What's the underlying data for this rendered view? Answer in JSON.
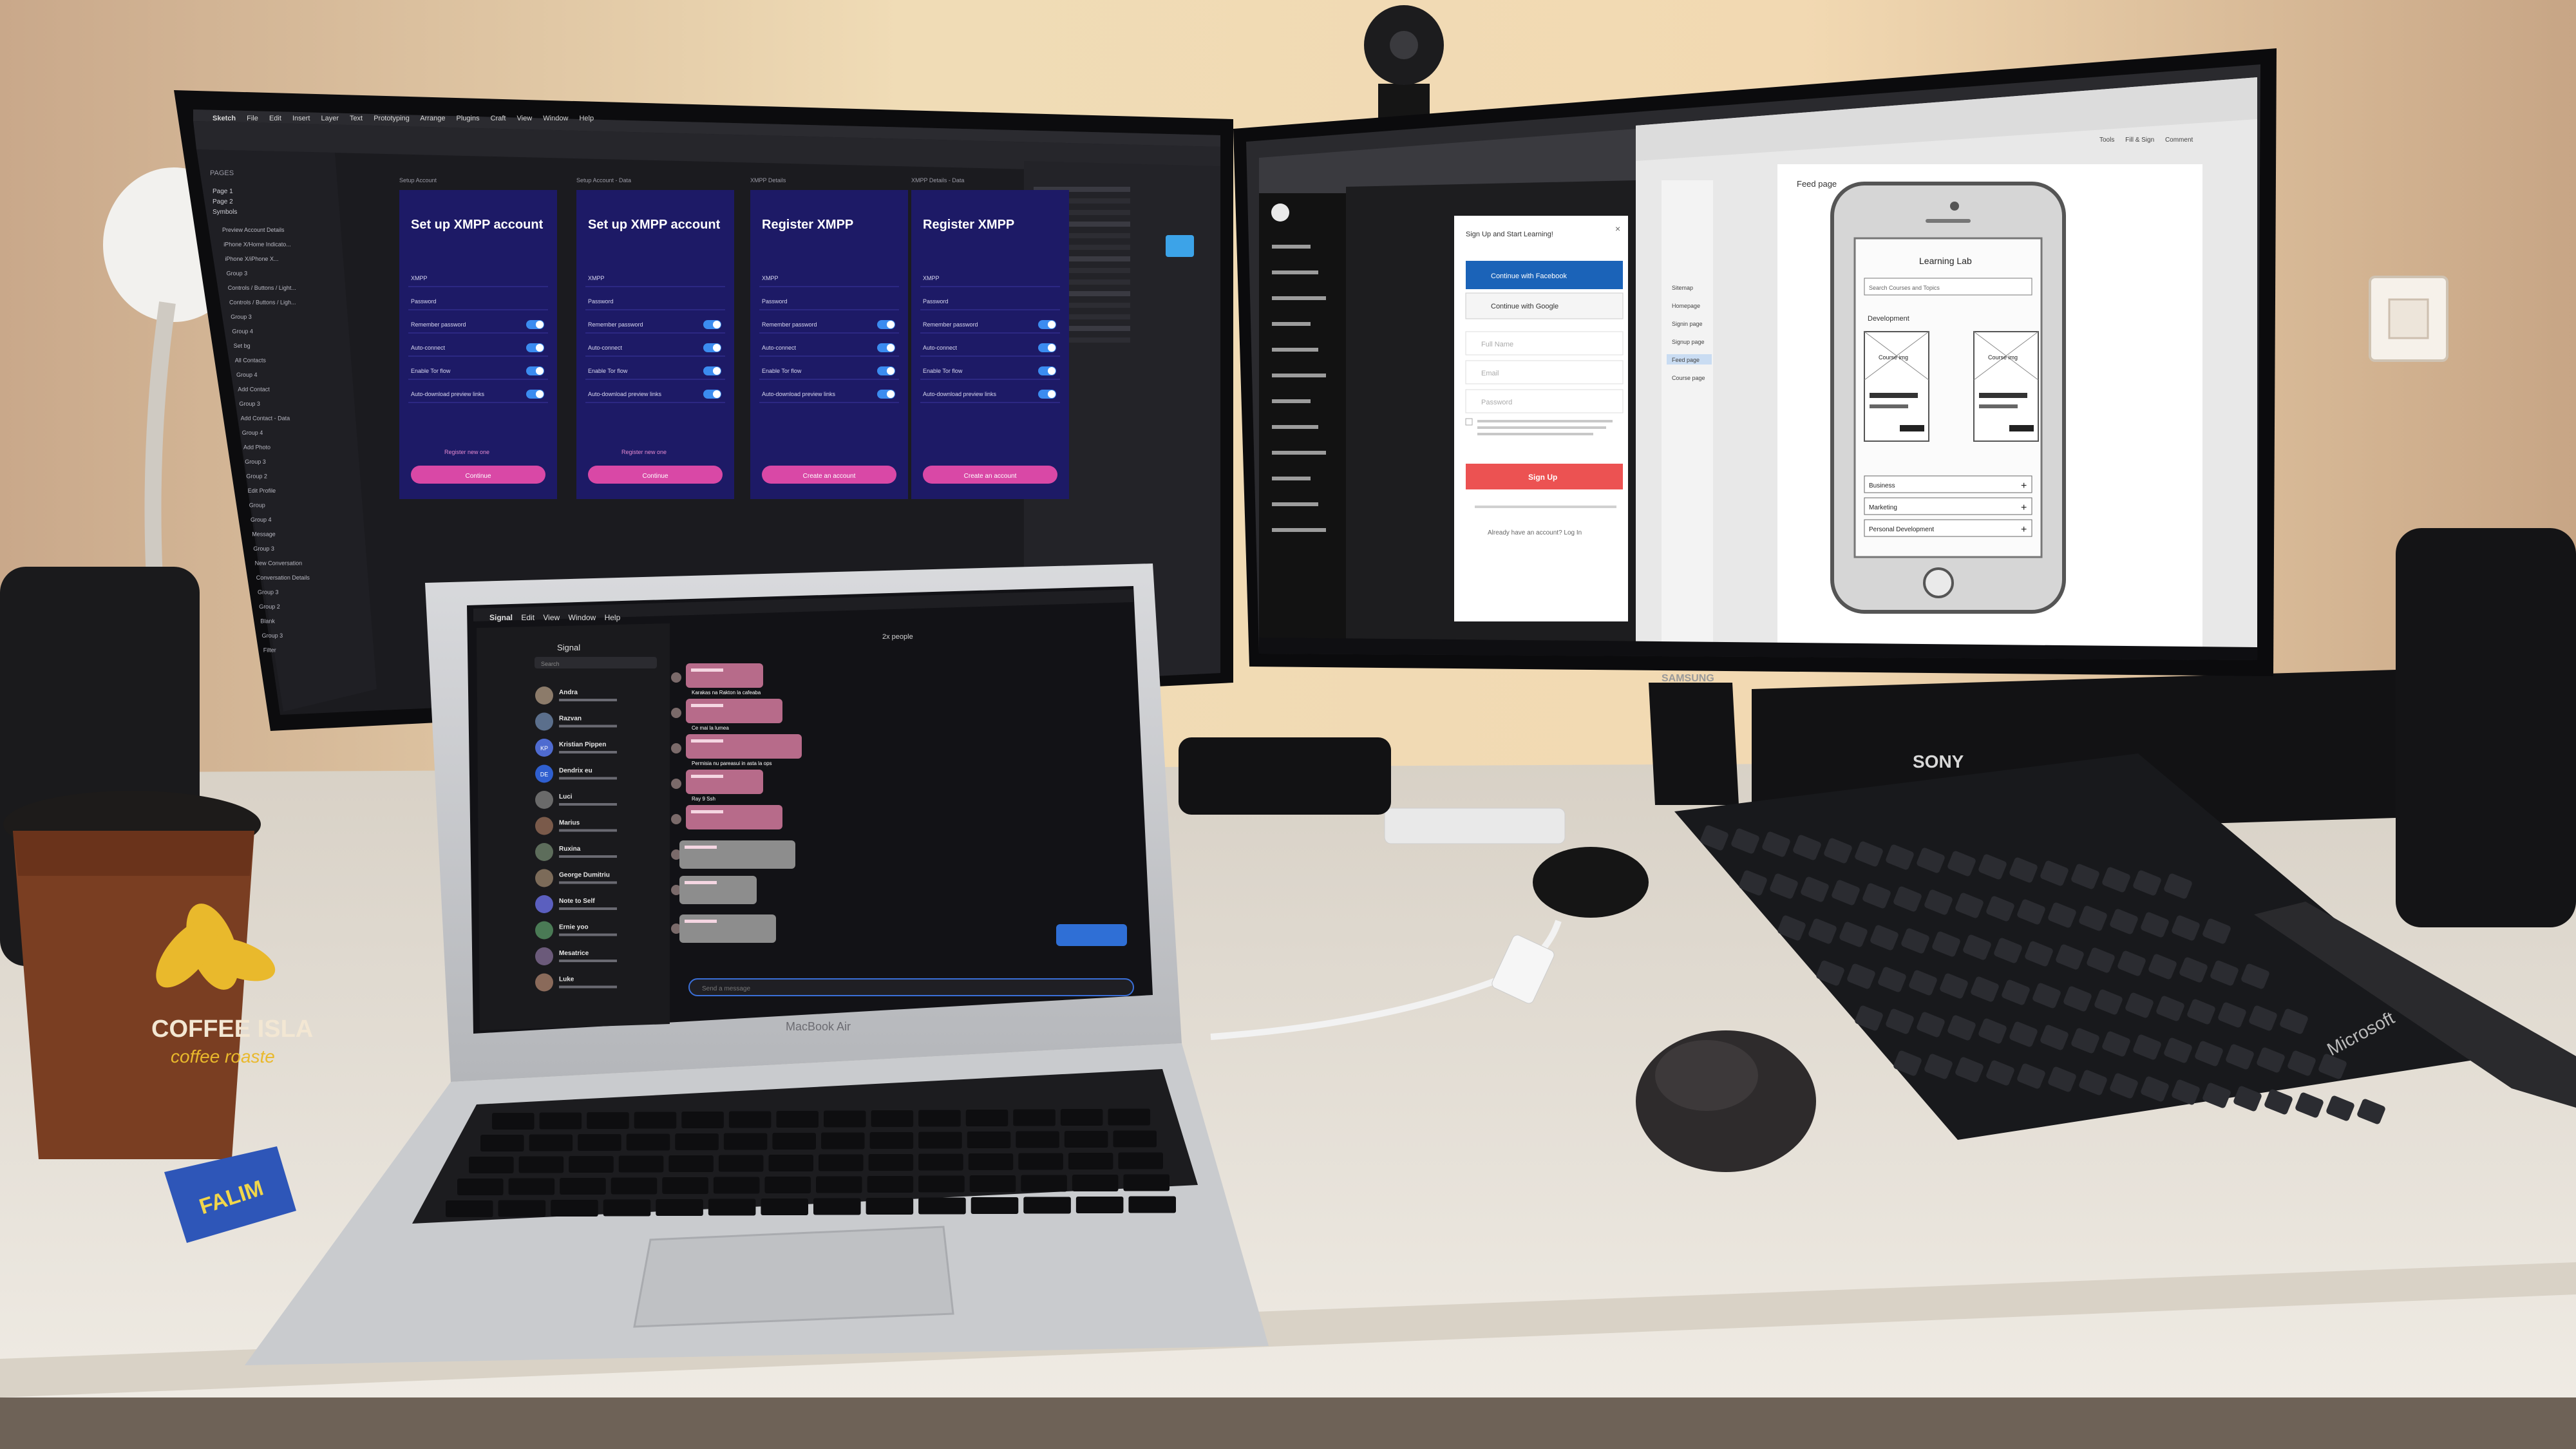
{
  "colors": {
    "wall": "#e7cfa8",
    "desk": "#ece7df",
    "sketch_bg": "#1b1b1f",
    "artboard": "#1d1a66",
    "accent_pink": "#d948a6",
    "signal_bubble": "#b76b8a",
    "udemy_red": "#ec5252",
    "facebook_blue": "#1b63b8"
  },
  "left_monitor": {
    "app": "Sketch",
    "menu": [
      "Sketch",
      "File",
      "Edit",
      "Insert",
      "Layer",
      "Text",
      "Prototyping",
      "Arrange",
      "Plugins",
      "Craft",
      "View",
      "Window",
      "Help"
    ],
    "sidebar_header": "PAGES",
    "pages": [
      "Page 1",
      "Page 2",
      "Symbols"
    ],
    "layers": [
      "Preview Account Details",
      "iPhone X/Home Indicato...",
      "iPhone X/iPhone X...",
      "Group 3",
      "Controls / Buttons / Light...",
      "Controls / Buttons / Ligh...",
      "Group 3",
      "Group 4",
      "Set bg",
      "All Contacts",
      "Group 4",
      "Add Contact",
      "Group 3",
      "Add Contact - Data",
      "Group 4",
      "Add Photo",
      "Group 3",
      "Group 2",
      "Edit Profile",
      "Group",
      "Group 4",
      "Message",
      "Group 3",
      "New Conversation",
      "Conversation Details",
      "Group 3",
      "Group 2",
      "Blank",
      "Group 3",
      "Filter"
    ],
    "artboards": [
      {
        "label": "Setup Account",
        "title": "Set up XMPP account",
        "button": "Continue"
      },
      {
        "label": "Setup Account - Data",
        "title": "Set up XMPP account",
        "button": "Continue"
      },
      {
        "label": "XMPP Details",
        "title": "Register XMPP",
        "button": "Create an account"
      },
      {
        "label": "XMPP Details - Data",
        "title": "Register XMPP",
        "button": "Create an account"
      }
    ],
    "form_rows": [
      "XMPP",
      "Password",
      "Remember password",
      "Auto-connect",
      "Enable Tor flow",
      "Auto-download preview links"
    ],
    "register_link": "Register new one"
  },
  "right_monitor": {
    "brand": "SAMSUNG",
    "signup": {
      "title": "Sign Up and Start Learning!",
      "facebook": "Continue with Facebook",
      "google": "Continue with Google",
      "name": "Full Name",
      "email": "Email",
      "password": "Password",
      "cta": "Sign Up",
      "login": "Already have an account? Log In"
    },
    "pdf": {
      "bookmarks": [
        "Sitemap",
        "Homepage",
        "Signin page",
        "Signup page",
        "Feed page",
        "Course page"
      ],
      "page_title": "Feed page",
      "app_title": "Learning Lab",
      "search": "Search Courses and Topics",
      "section": "Development",
      "card": "Course img",
      "categories": [
        "Business",
        "Marketing",
        "Personal Development"
      ],
      "right_tools": [
        "Tools",
        "Fill & Sign",
        "Comment"
      ]
    }
  },
  "laptop": {
    "brand": "MacBook Air",
    "app": "Signal",
    "menu": [
      "Signal",
      "Edit",
      "View",
      "Window",
      "Help"
    ],
    "header": "2x people",
    "search_placeholder": "Search",
    "compose_placeholder": "Send a message",
    "conversations": [
      {
        "name": "Andra",
        "time": "",
        "initials": ""
      },
      {
        "name": "Razvan",
        "time": "",
        "initials": ""
      },
      {
        "name": "Kristian Pippen",
        "time": "",
        "initials": "KP"
      },
      {
        "name": "Dendrix eu",
        "time": "",
        "initials": "DE"
      },
      {
        "name": "Luci",
        "time": "",
        "initials": ""
      },
      {
        "name": "Marius",
        "time": "",
        "initials": ""
      },
      {
        "name": "Ruxina",
        "time": "",
        "initials": ""
      },
      {
        "name": "George Dumitriu",
        "time": "",
        "initials": ""
      },
      {
        "name": "Note to Self",
        "time": "",
        "initials": ""
      },
      {
        "name": "Ernie yoo",
        "time": "",
        "initials": ""
      },
      {
        "name": "Mesatrice",
        "time": "",
        "initials": ""
      },
      {
        "name": "Luke",
        "time": "",
        "initials": ""
      }
    ],
    "messages": [
      "Karakas na Rakton la cafeaba",
      "Ce mai la lumea",
      "Permisia nu pareasui in asta la ops",
      "Ray 9 Ssh"
    ]
  },
  "cup": {
    "brand": "COFFEE ISLA",
    "tagline": "coffee roaste"
  },
  "candy": "FALIM",
  "receiver_brand": "SONY",
  "keyboard_brand": "Microsoft"
}
